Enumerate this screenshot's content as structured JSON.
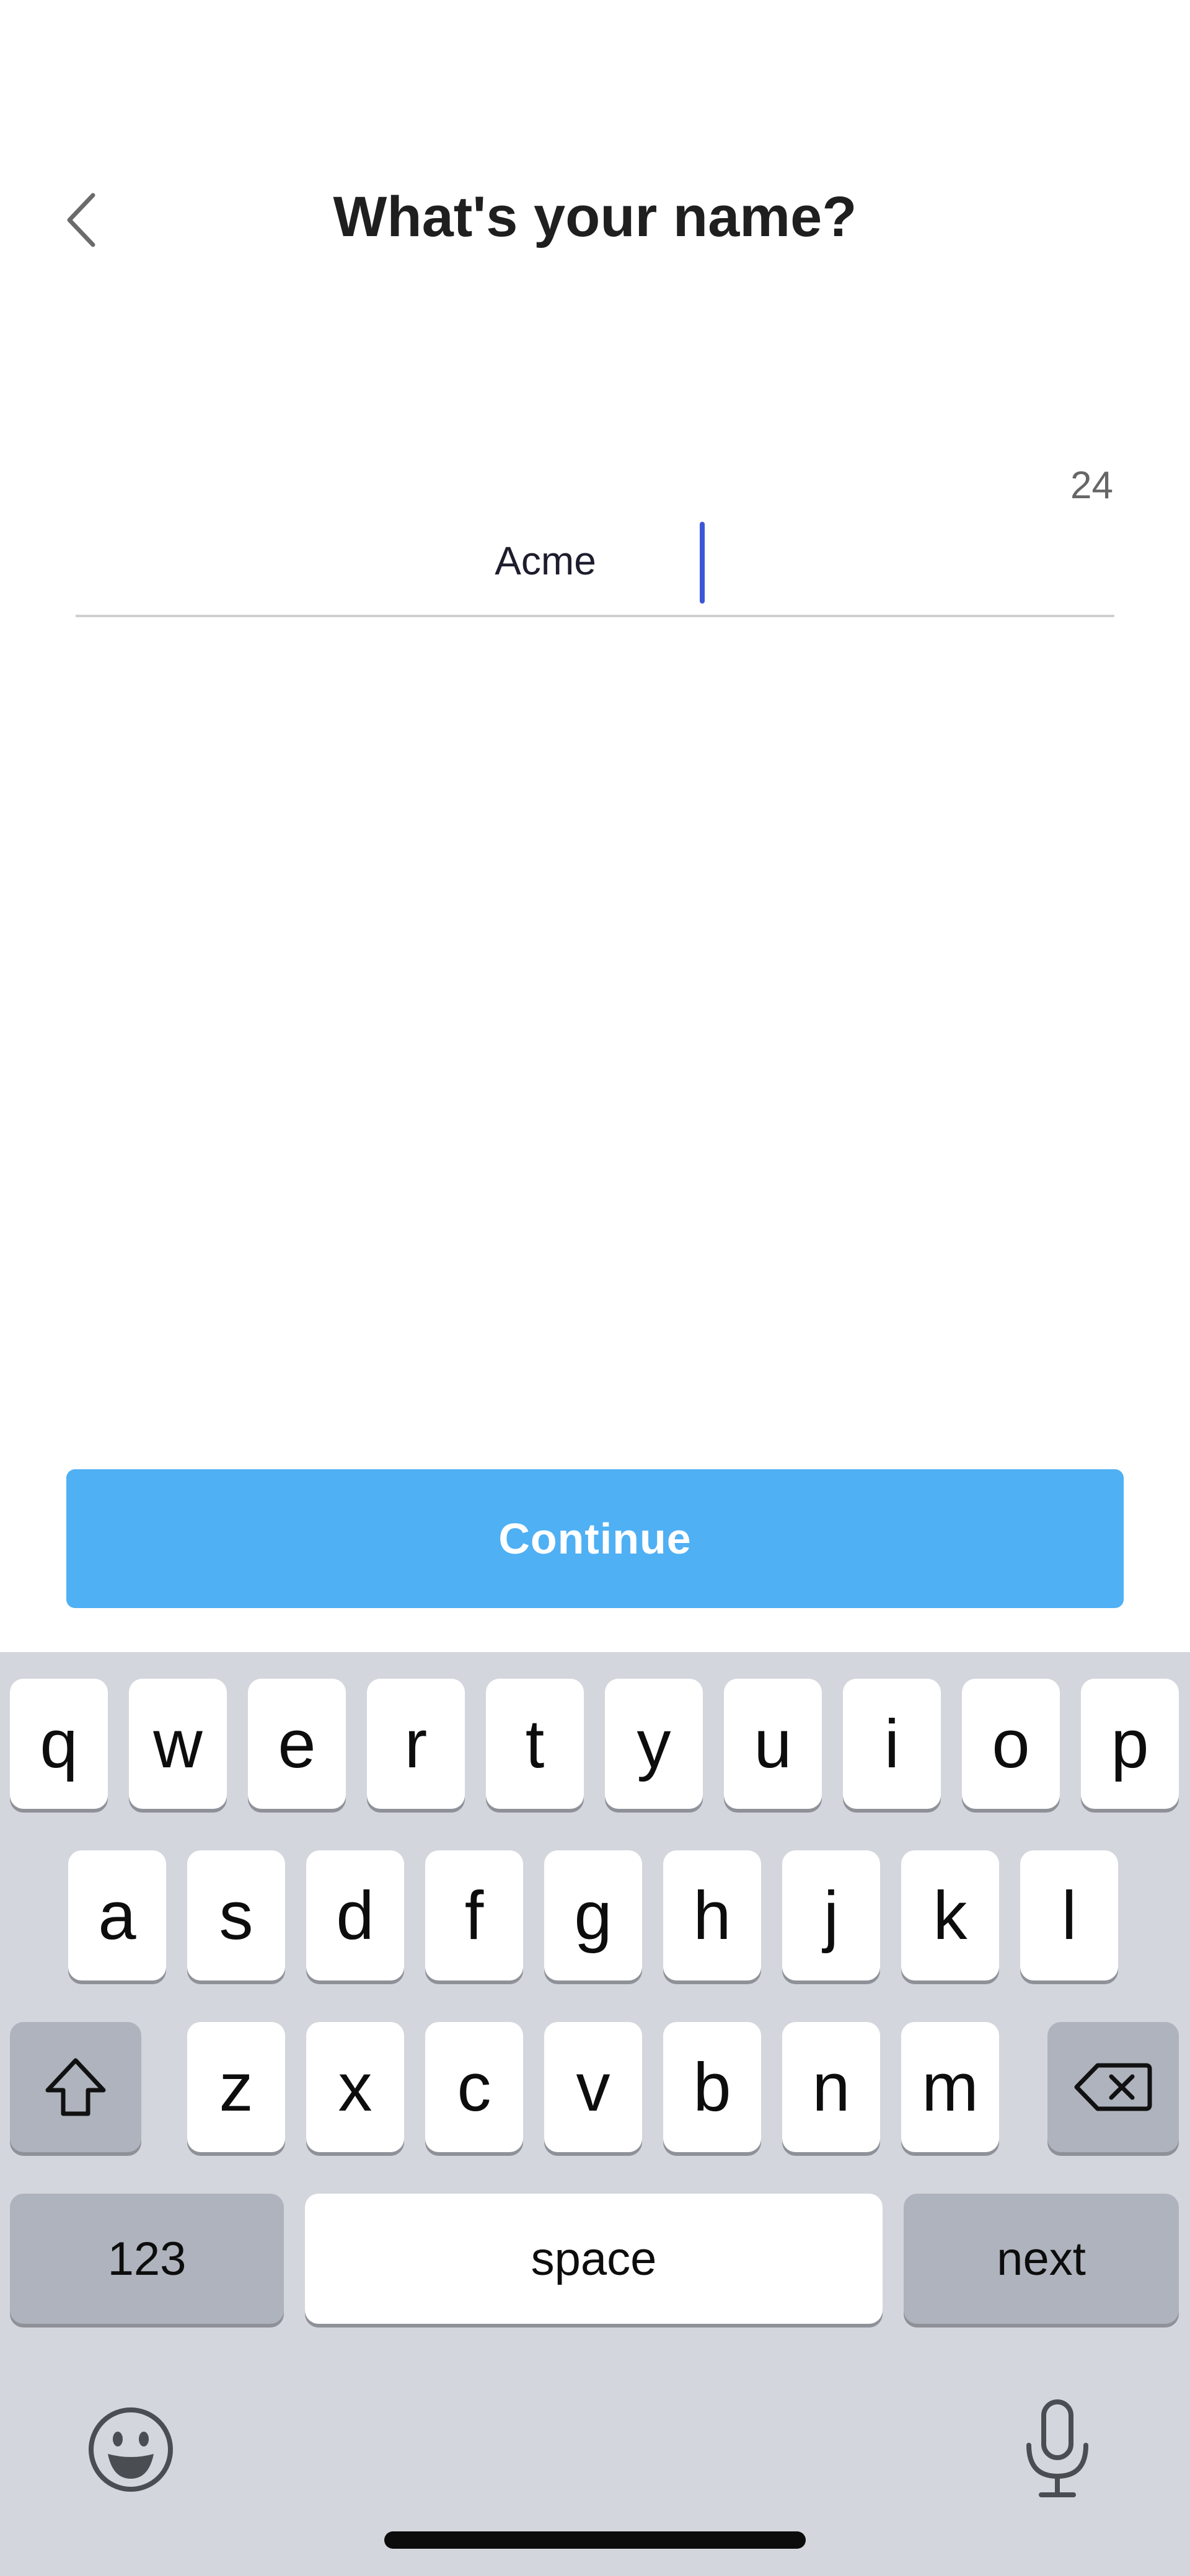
{
  "header": {
    "title": "What's your name?"
  },
  "name_field": {
    "value": "Acme",
    "remaining_count": "24"
  },
  "continue_button": {
    "label": "Continue"
  },
  "keyboard": {
    "row1": [
      "q",
      "w",
      "e",
      "r",
      "t",
      "y",
      "u",
      "i",
      "o",
      "p"
    ],
    "row2": [
      "a",
      "s",
      "d",
      "f",
      "g",
      "h",
      "j",
      "k",
      "l"
    ],
    "row3": [
      "z",
      "x",
      "c",
      "v",
      "b",
      "n",
      "m"
    ],
    "numbers_label": "123",
    "space_label": "space",
    "next_label": "next",
    "icons": [
      "shift-icon",
      "backspace-icon",
      "emoji-icon",
      "microphone-icon"
    ]
  },
  "colors": {
    "accent": "#4fb0f4",
    "caret": "#3b57d6",
    "keyboard_bg": "#d3d6dc",
    "function_key": "#aeb3bd"
  }
}
